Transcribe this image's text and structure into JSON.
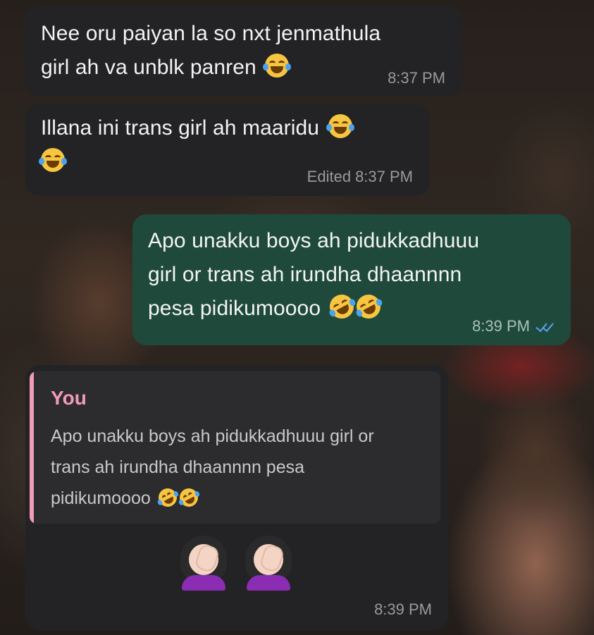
{
  "messages": [
    {
      "direction": "incoming",
      "lines": [
        "Nee oru paiyan la so nxt jenmathula",
        "girl ah va unblk panren"
      ],
      "emojis": [
        "face-with-tears-of-joy"
      ],
      "time": "8:37 PM"
    },
    {
      "direction": "incoming",
      "lines": [
        "Illana ini trans girl ah maaridu"
      ],
      "emojis": [
        "face-with-tears-of-joy",
        "face-with-tears-of-joy"
      ],
      "edited_label": "Edited",
      "time": "8:37 PM"
    },
    {
      "direction": "outgoing",
      "lines": [
        "Apo unakku boys ah pidukkadhuuu",
        "girl or trans ah irundha dhaannnn",
        "pesa pidikumoooo"
      ],
      "emojis": [
        "rolling-on-floor-laughing",
        "rolling-on-floor-laughing"
      ],
      "time": "8:39 PM",
      "status": "read-double-tick"
    },
    {
      "direction": "incoming",
      "reply": {
        "author": "You",
        "lines": [
          "Apo unakku boys ah pidukkadhuuu girl or",
          "trans ah irundha dhaannnn pesa",
          "pidikumoooo"
        ],
        "emojis": [
          "rolling-on-floor-laughing",
          "rolling-on-floor-laughing"
        ]
      },
      "emojis": [
        "woman-facepalming",
        "woman-facepalming"
      ],
      "time": "8:39 PM"
    }
  ],
  "colors": {
    "incoming_bubble": "#232325",
    "outgoing_bubble": "#1f4a3b",
    "reply_accent": "#f29bb8",
    "read_tick": "#58a6f0"
  }
}
